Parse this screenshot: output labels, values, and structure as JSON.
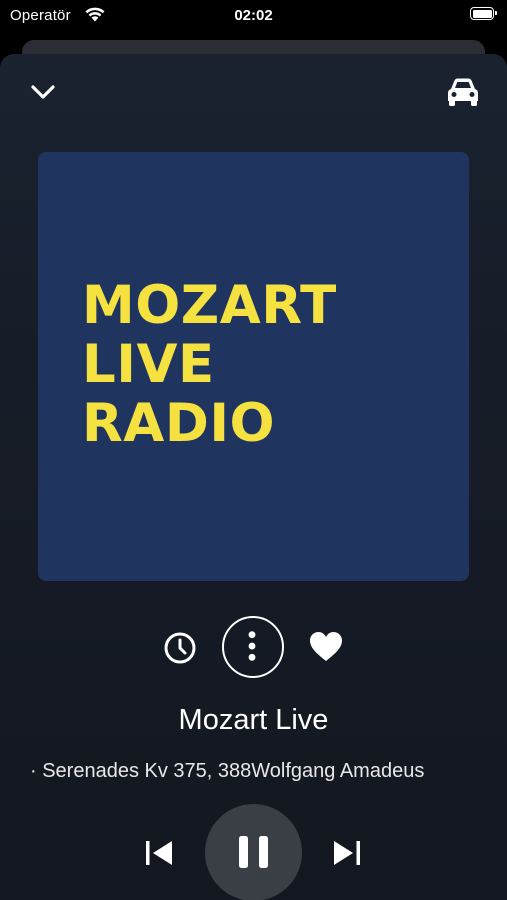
{
  "status_bar": {
    "carrier": "Operatör",
    "time": "02:02"
  },
  "header": {
    "collapse_icon": "chevron-down-icon",
    "car_mode_icon": "car-icon"
  },
  "artwork": {
    "lines": [
      "MOZART",
      "LIVE",
      "RADIO"
    ],
    "background_color": "#1f3560",
    "text_color": "#f5e13f"
  },
  "actions": {
    "timer_icon": "clock-icon",
    "more_icon": "more-vertical-icon",
    "favorite_icon": "heart-icon"
  },
  "now_playing": {
    "station": "Mozart Live",
    "track": "· Serenades Kv 375, 388Wolfgang Amadeus"
  },
  "playback": {
    "prev_icon": "skip-previous-icon",
    "play_pause_icon": "pause-icon",
    "next_icon": "skip-next-icon"
  }
}
